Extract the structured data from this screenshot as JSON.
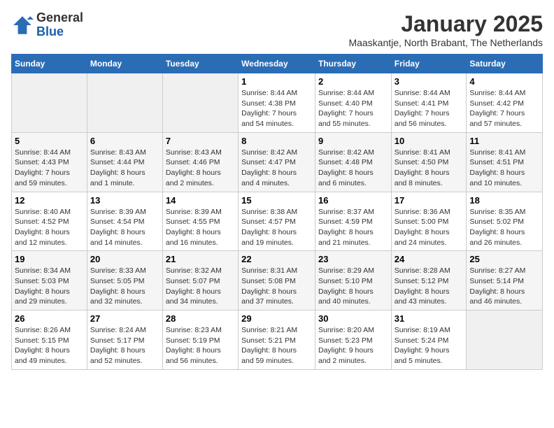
{
  "header": {
    "logo_general": "General",
    "logo_blue": "Blue",
    "title": "January 2025",
    "location": "Maaskantje, North Brabant, The Netherlands"
  },
  "weekdays": [
    "Sunday",
    "Monday",
    "Tuesday",
    "Wednesday",
    "Thursday",
    "Friday",
    "Saturday"
  ],
  "weeks": [
    [
      {
        "day": "",
        "info": ""
      },
      {
        "day": "",
        "info": ""
      },
      {
        "day": "",
        "info": ""
      },
      {
        "day": "1",
        "info": "Sunrise: 8:44 AM\nSunset: 4:38 PM\nDaylight: 7 hours\nand 54 minutes."
      },
      {
        "day": "2",
        "info": "Sunrise: 8:44 AM\nSunset: 4:40 PM\nDaylight: 7 hours\nand 55 minutes."
      },
      {
        "day": "3",
        "info": "Sunrise: 8:44 AM\nSunset: 4:41 PM\nDaylight: 7 hours\nand 56 minutes."
      },
      {
        "day": "4",
        "info": "Sunrise: 8:44 AM\nSunset: 4:42 PM\nDaylight: 7 hours\nand 57 minutes."
      }
    ],
    [
      {
        "day": "5",
        "info": "Sunrise: 8:44 AM\nSunset: 4:43 PM\nDaylight: 7 hours\nand 59 minutes."
      },
      {
        "day": "6",
        "info": "Sunrise: 8:43 AM\nSunset: 4:44 PM\nDaylight: 8 hours\nand 1 minute."
      },
      {
        "day": "7",
        "info": "Sunrise: 8:43 AM\nSunset: 4:46 PM\nDaylight: 8 hours\nand 2 minutes."
      },
      {
        "day": "8",
        "info": "Sunrise: 8:42 AM\nSunset: 4:47 PM\nDaylight: 8 hours\nand 4 minutes."
      },
      {
        "day": "9",
        "info": "Sunrise: 8:42 AM\nSunset: 4:48 PM\nDaylight: 8 hours\nand 6 minutes."
      },
      {
        "day": "10",
        "info": "Sunrise: 8:41 AM\nSunset: 4:50 PM\nDaylight: 8 hours\nand 8 minutes."
      },
      {
        "day": "11",
        "info": "Sunrise: 8:41 AM\nSunset: 4:51 PM\nDaylight: 8 hours\nand 10 minutes."
      }
    ],
    [
      {
        "day": "12",
        "info": "Sunrise: 8:40 AM\nSunset: 4:52 PM\nDaylight: 8 hours\nand 12 minutes."
      },
      {
        "day": "13",
        "info": "Sunrise: 8:39 AM\nSunset: 4:54 PM\nDaylight: 8 hours\nand 14 minutes."
      },
      {
        "day": "14",
        "info": "Sunrise: 8:39 AM\nSunset: 4:55 PM\nDaylight: 8 hours\nand 16 minutes."
      },
      {
        "day": "15",
        "info": "Sunrise: 8:38 AM\nSunset: 4:57 PM\nDaylight: 8 hours\nand 19 minutes."
      },
      {
        "day": "16",
        "info": "Sunrise: 8:37 AM\nSunset: 4:59 PM\nDaylight: 8 hours\nand 21 minutes."
      },
      {
        "day": "17",
        "info": "Sunrise: 8:36 AM\nSunset: 5:00 PM\nDaylight: 8 hours\nand 24 minutes."
      },
      {
        "day": "18",
        "info": "Sunrise: 8:35 AM\nSunset: 5:02 PM\nDaylight: 8 hours\nand 26 minutes."
      }
    ],
    [
      {
        "day": "19",
        "info": "Sunrise: 8:34 AM\nSunset: 5:03 PM\nDaylight: 8 hours\nand 29 minutes."
      },
      {
        "day": "20",
        "info": "Sunrise: 8:33 AM\nSunset: 5:05 PM\nDaylight: 8 hours\nand 32 minutes."
      },
      {
        "day": "21",
        "info": "Sunrise: 8:32 AM\nSunset: 5:07 PM\nDaylight: 8 hours\nand 34 minutes."
      },
      {
        "day": "22",
        "info": "Sunrise: 8:31 AM\nSunset: 5:08 PM\nDaylight: 8 hours\nand 37 minutes."
      },
      {
        "day": "23",
        "info": "Sunrise: 8:29 AM\nSunset: 5:10 PM\nDaylight: 8 hours\nand 40 minutes."
      },
      {
        "day": "24",
        "info": "Sunrise: 8:28 AM\nSunset: 5:12 PM\nDaylight: 8 hours\nand 43 minutes."
      },
      {
        "day": "25",
        "info": "Sunrise: 8:27 AM\nSunset: 5:14 PM\nDaylight: 8 hours\nand 46 minutes."
      }
    ],
    [
      {
        "day": "26",
        "info": "Sunrise: 8:26 AM\nSunset: 5:15 PM\nDaylight: 8 hours\nand 49 minutes."
      },
      {
        "day": "27",
        "info": "Sunrise: 8:24 AM\nSunset: 5:17 PM\nDaylight: 8 hours\nand 52 minutes."
      },
      {
        "day": "28",
        "info": "Sunrise: 8:23 AM\nSunset: 5:19 PM\nDaylight: 8 hours\nand 56 minutes."
      },
      {
        "day": "29",
        "info": "Sunrise: 8:21 AM\nSunset: 5:21 PM\nDaylight: 8 hours\nand 59 minutes."
      },
      {
        "day": "30",
        "info": "Sunrise: 8:20 AM\nSunset: 5:23 PM\nDaylight: 9 hours\nand 2 minutes."
      },
      {
        "day": "31",
        "info": "Sunrise: 8:19 AM\nSunset: 5:24 PM\nDaylight: 9 hours\nand 5 minutes."
      },
      {
        "day": "",
        "info": ""
      }
    ]
  ]
}
